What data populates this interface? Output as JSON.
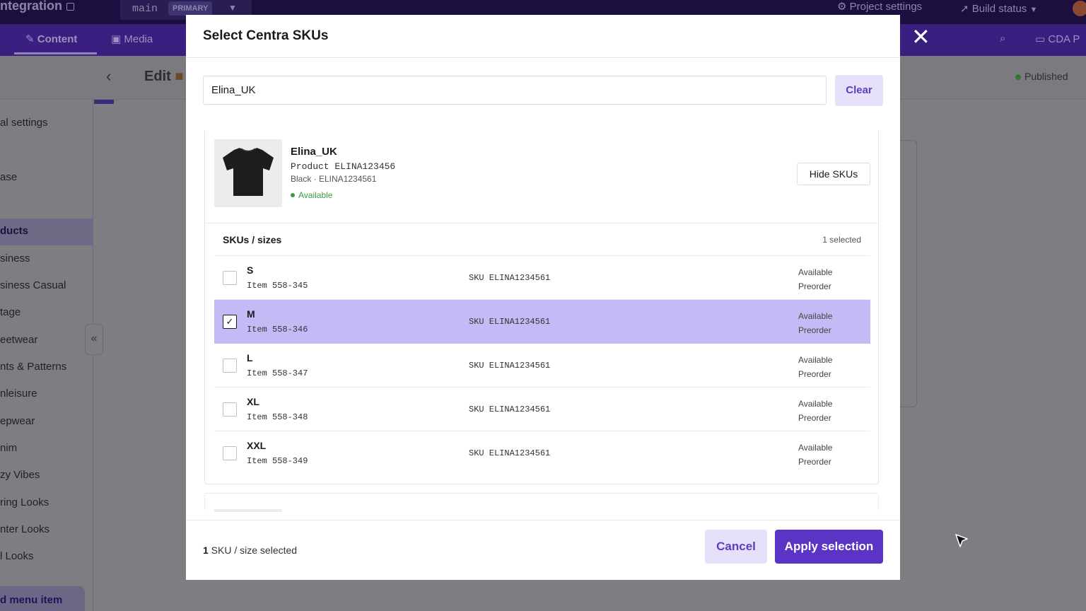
{
  "app": {
    "brand": "ntegration",
    "branch": "main",
    "branch_badge": "PRIMARY",
    "project_settings": "Project settings",
    "build_status": "Build status",
    "nav_content": "Content",
    "nav_media": "Media",
    "nav_cda": "CDA P",
    "edit_title": "Edit",
    "publish_status": "Published"
  },
  "sidebar": {
    "items": [
      "al settings",
      "ase",
      "ducts",
      "siness",
      "siness Casual",
      "tage",
      "eetwear",
      "nts & Patterns",
      "nleisure",
      "epwear",
      "nim",
      "zy Vibes",
      "ring Looks",
      "nter Looks",
      "l Looks"
    ],
    "active_item": "ducts",
    "add_menu_item": "d menu item"
  },
  "modal": {
    "title": "Select Centra SKUs",
    "search_value": "Elina_UK",
    "clear_label": "Clear",
    "product": {
      "name": "Elina_UK",
      "product_line": "Product ELINA123456",
      "variant_line": "Black · ELINA1234561",
      "status": "Available",
      "hide_skus_label": "Hide SKUs"
    },
    "skus_title": "SKUs / sizes",
    "selected_count": "1 selected",
    "skus": [
      {
        "size": "S",
        "item": "Item 558-345",
        "sku": "SKU ELINA1234561",
        "status1": "Available",
        "status2": "Preorder",
        "checked": false,
        "check_mark": ""
      },
      {
        "size": "M",
        "item": "Item 558-346",
        "sku": "SKU ELINA1234561",
        "status1": "Available",
        "status2": "Preorder",
        "checked": true,
        "check_mark": "✓"
      },
      {
        "size": "L",
        "item": "Item 558-347",
        "sku": "SKU ELINA1234561",
        "status1": "Available",
        "status2": "Preorder",
        "checked": false,
        "check_mark": ""
      },
      {
        "size": "XL",
        "item": "Item 558-348",
        "sku": "SKU ELINA1234561",
        "status1": "Available",
        "status2": "Preorder",
        "checked": false,
        "check_mark": ""
      },
      {
        "size": "XXL",
        "item": "Item 558-349",
        "sku": "SKU ELINA1234561",
        "status1": "Available",
        "status2": "Preorder",
        "checked": false,
        "check_mark": ""
      }
    ],
    "footer_count_num": "1",
    "footer_count_text": " SKU / size selected",
    "cancel_label": "Cancel",
    "apply_label": "Apply selection"
  },
  "colors": {
    "accent": "#5b34c6",
    "accent_light": "#e6e0fb",
    "selected_row": "#c6baf6",
    "available_green": "#3d9a40"
  },
  "icons": {
    "close": "close-icon",
    "search": "search-icon",
    "back": "back-arrow-icon",
    "checkmark": "checkmark-icon",
    "collapse": "double-chevron-left-icon",
    "cursor": "mouse-pointer-icon"
  }
}
